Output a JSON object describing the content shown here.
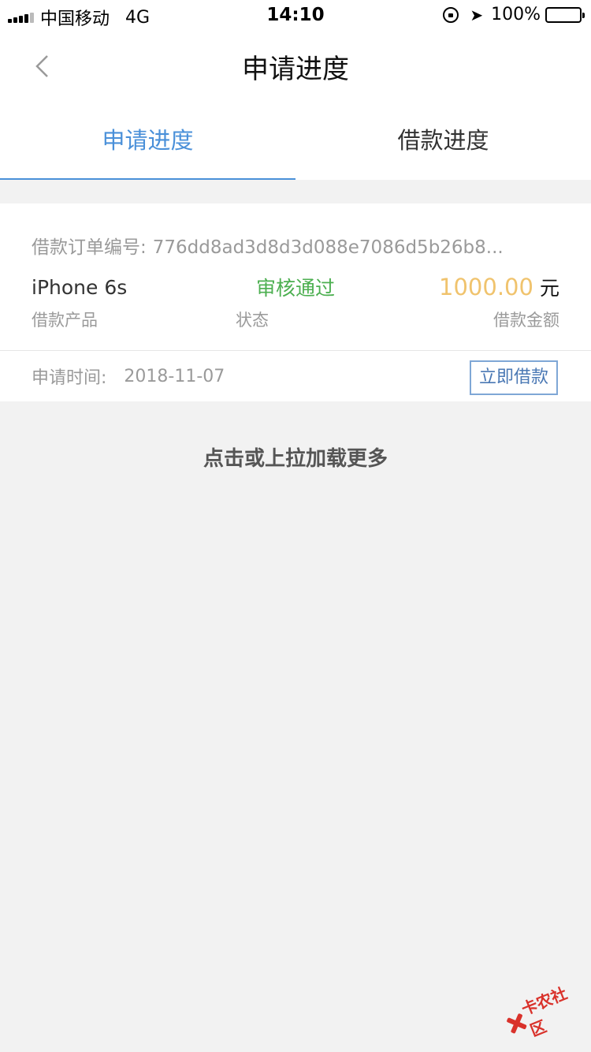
{
  "status_bar": {
    "carrier": "中国移动",
    "network": "4G",
    "time": "14:10",
    "battery": "100%",
    "icons": [
      "signal-icon",
      "orientation-lock-icon",
      "location-arrow-icon",
      "battery-icon"
    ]
  },
  "nav": {
    "title": "申请进度",
    "back_icon": "chevron-left-icon"
  },
  "tabs": [
    {
      "label": "申请进度",
      "active": true
    },
    {
      "label": "借款进度",
      "active": false
    }
  ],
  "order": {
    "order_no_label": "借款订单编号:",
    "order_no": "776dd8ad3d8d3d088e7086d5b26b8...",
    "product": "iPhone 6s",
    "product_label": "借款产品",
    "status": "审核通过",
    "status_label": "状态",
    "amount": "1000.00",
    "currency": "元",
    "amount_label": "借款金额",
    "apply_time_label": "申请时间:",
    "apply_time": "2018-11-07",
    "borrow_button": "立即借款"
  },
  "load_more": "点击或上拉加载更多",
  "watermark": {
    "text": "卡农社区"
  },
  "colors": {
    "accent": "#4a90d9",
    "status_ok": "#4caf50",
    "amount": "#f0c36d",
    "button_border": "#7fa7d6",
    "watermark": "#d9322b"
  }
}
